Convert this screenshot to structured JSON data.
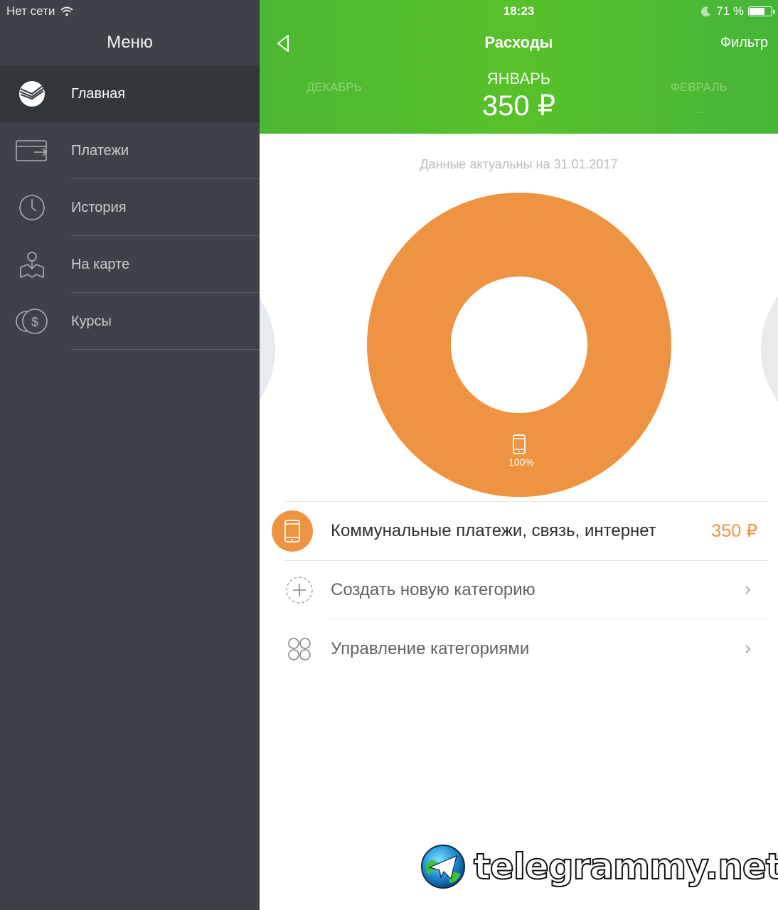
{
  "status_bar": {
    "network": "Нет сети",
    "time": "18:23",
    "battery": "71 %",
    "battery_level": 0.71
  },
  "sidebar": {
    "title": "Меню",
    "items": [
      {
        "label": "Главная",
        "icon": "sberbank-logo-icon",
        "active": true
      },
      {
        "label": "Платежи",
        "icon": "card-transfer-icon",
        "active": false
      },
      {
        "label": "История",
        "icon": "clock-icon",
        "active": false
      },
      {
        "label": "На карте",
        "icon": "map-person-icon",
        "active": false
      },
      {
        "label": "Курсы",
        "icon": "currency-dollar-icon",
        "active": false
      }
    ]
  },
  "header": {
    "title": "Расходы",
    "filter_label": "Фильтр",
    "prev_month": "ДЕКАБРЬ",
    "current_month": "ЯНВАРЬ",
    "next_month": "ФЕВРАЛЬ",
    "next_month_dots": "...",
    "amount": "350 ₽"
  },
  "summary": {
    "actual_date": "Данные актуальны на 31.01.2017"
  },
  "chart_data": {
    "type": "pie",
    "categories": [
      "Коммунальные платежи, связь, интернет"
    ],
    "values": [
      100
    ],
    "slice_labels": [
      "100%"
    ],
    "colors": [
      "#ee9341"
    ]
  },
  "categories": [
    {
      "name": "Коммунальные платежи, связь, интернет",
      "amount": "350 ₽",
      "icon": "phone-icon"
    }
  ],
  "actions": {
    "create_label": "Создать новую категорию",
    "manage_label": "Управление категориями"
  },
  "colors": {
    "sidebar_bg": "#3c4247",
    "header_green": "#52bc30",
    "accent_orange": "#ee9341"
  },
  "watermark": "telegrammy.net"
}
